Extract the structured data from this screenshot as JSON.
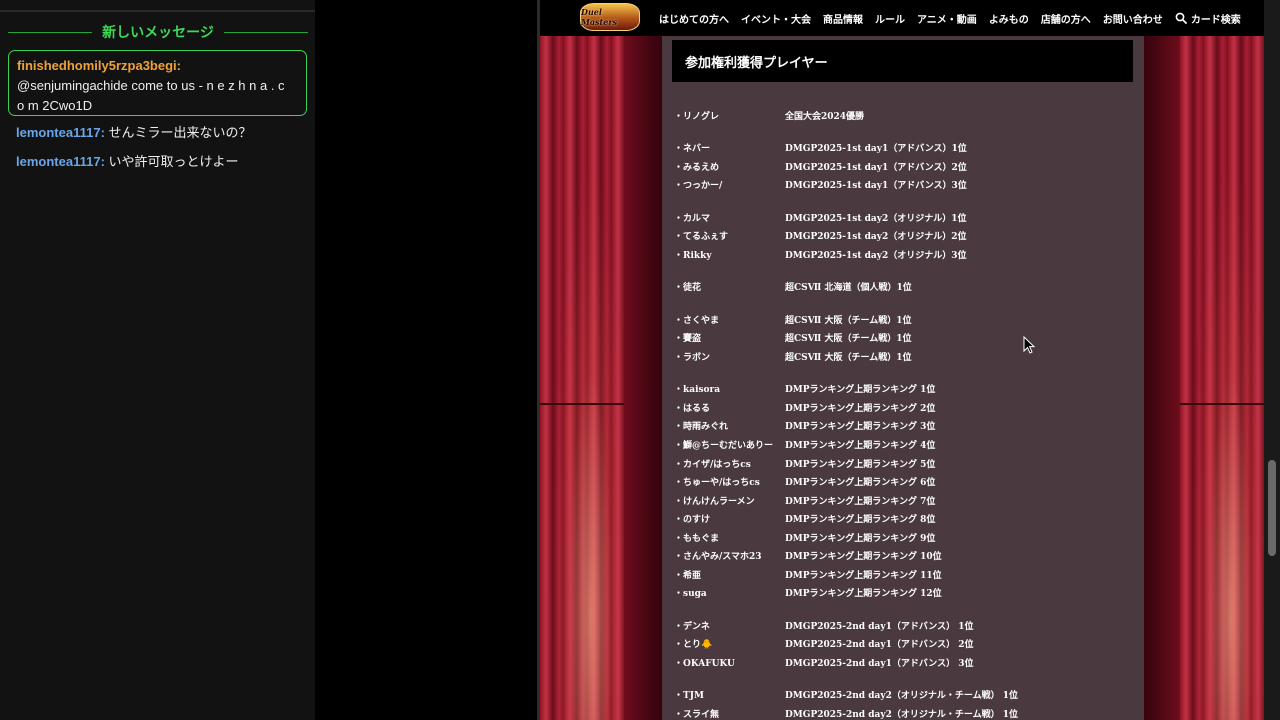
{
  "chat": {
    "new_messages_label": "新しいメッセージ",
    "highlighted": {
      "user": "finishedhomily5rzpa3begi",
      "line1": "@senjumingachide come to us - n e z h n a . c",
      "line2": "o m 2Cwo1D"
    },
    "messages": [
      {
        "user": "lemontea1117",
        "text": " せんミラー出来ないの？"
      },
      {
        "user": "lemontea1117",
        "text": " いや許可取っとけよー"
      }
    ]
  },
  "site": {
    "logo_text": "Duel Masters",
    "nav": [
      "はじめての方へ",
      "イベント・大会",
      "商品情報",
      "ルール",
      "アニメ・動画",
      "よみもの",
      "店舗の方へ",
      "お問い合わせ"
    ],
    "search_label": "カード検索",
    "section_title": "参加権利獲得プレイヤー",
    "players": [
      {
        "name": "・リノグレ",
        "result": "全国大会2024優勝"
      },
      {
        "name": "・ネバー",
        "result": "DMGP2025-1st day1（アドバンス）1位"
      },
      {
        "name": "・みるえめ",
        "result": "DMGP2025-1st day1（アドバンス）2位"
      },
      {
        "name": "・つっかー/",
        "result": "DMGP2025-1st day1（アドバンス）3位"
      },
      {
        "name": "・カルマ",
        "result": "DMGP2025-1st day2（オリジナル）1位"
      },
      {
        "name": "・てるふぇす",
        "result": "DMGP2025-1st day2（オリジナル）2位"
      },
      {
        "name": "・Rikky",
        "result": "DMGP2025-1st day2（オリジナル）3位"
      },
      {
        "name": "・徒花",
        "result": "超CSⅦ 北海道（個人戦）1位"
      },
      {
        "name": "・さくやま",
        "result": "超CSⅦ 大阪（チーム戦）1位"
      },
      {
        "name": "・賽盗",
        "result": "超CSⅦ 大阪（チーム戦）1位"
      },
      {
        "name": "・ラボン",
        "result": "超CSⅦ 大阪（チーム戦）1位"
      },
      {
        "name": "・kaisora",
        "result": "DMPランキング上期ランキング 1位"
      },
      {
        "name": "・はるる",
        "result": "DMPランキング上期ランキング 2位"
      },
      {
        "name": "・時雨みぐれ",
        "result": "DMPランキング上期ランキング 3位"
      },
      {
        "name": "・鰤@ちーむだいありー",
        "result": "DMPランキング上期ランキング 4位"
      },
      {
        "name": "・カイザ/はっちcs",
        "result": "DMPランキング上期ランキング 5位"
      },
      {
        "name": "・ちゅーや/はっちcs",
        "result": "DMPランキング上期ランキング 6位"
      },
      {
        "name": "・けんけんラーメン",
        "result": "DMPランキング上期ランキング 7位"
      },
      {
        "name": "・のすけ",
        "result": "DMPランキング上期ランキング 8位"
      },
      {
        "name": "・ももぐま",
        "result": "DMPランキング上期ランキング 9位"
      },
      {
        "name": "・さんやみ/スマホ23",
        "result": "DMPランキング上期ランキング 10位"
      },
      {
        "name": "・希亜",
        "result": "DMPランキング上期ランキング 11位"
      },
      {
        "name": "・suga",
        "result": "DMPランキング上期ランキング 12位"
      },
      {
        "name": "・デンネ",
        "result": "DMGP2025-2nd day1（アドバンス） 1位"
      },
      {
        "name": "・とり🐥",
        "result": "DMGP2025-2nd day1（アドバンス） 2位"
      },
      {
        "name": "・OKAFUKU",
        "result": "DMGP2025-2nd day1（アドバンス） 3位"
      },
      {
        "name": "・TJM",
        "result": "DMGP2025-2nd day2（オリジナル・チーム戦） 1位"
      },
      {
        "name": "・スライ無",
        "result": "DMGP2025-2nd day2（オリジナル・チーム戦） 1位"
      }
    ]
  }
}
